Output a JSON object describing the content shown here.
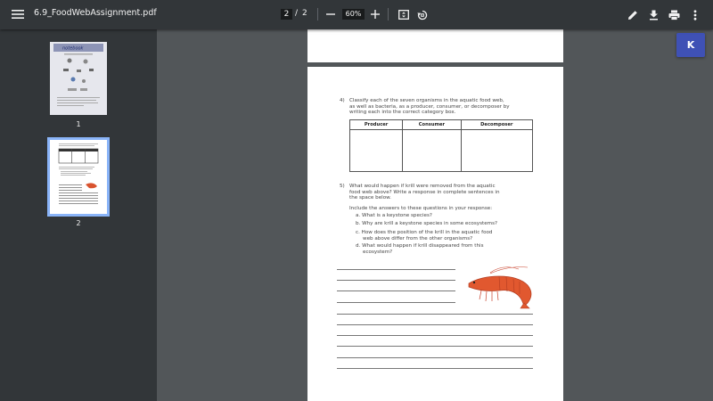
{
  "toolbar": {
    "file_name": "6.9_FoodWebAssignment.pdf",
    "current_page": "2",
    "page_separator": "/",
    "total_pages": "2",
    "zoom": "60%"
  },
  "sidebar": {
    "thumbnails": [
      {
        "label": "1"
      },
      {
        "label": "2"
      }
    ]
  },
  "extension": {
    "label": "K",
    "color": "#3f51b5"
  },
  "document": {
    "q4": {
      "number": "4)",
      "lines": [
        "Classify each of the seven organisms in the aquatic food web,",
        "as well as bacteria, as a producer, consumer, or decomposer by",
        "writing each into the correct category box."
      ],
      "table_headers": [
        "Producer",
        "Consumer",
        "Decomposer"
      ]
    },
    "q5": {
      "number": "5)",
      "lines": [
        "What would happen if krill were removed from the aquatic",
        "food web above? Write a response in complete sentences in",
        "the space below."
      ],
      "intro": "Include the answers to these questions in your response:",
      "items": [
        "a. What is a keystone species?",
        "b. Why are krill a keystone species in some ecosystems?",
        "c. How does the position of the krill in the aquatic food",
        "web above differ from the other organisms?",
        "d. What would happen if krill disappeared from this",
        "ecosystem?"
      ]
    }
  }
}
